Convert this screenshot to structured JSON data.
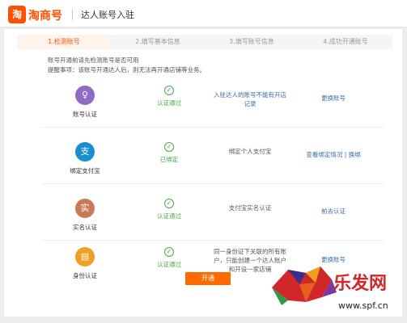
{
  "header": {
    "logo_glyph": "淘",
    "logo_text": "淘商号",
    "page_title": "达人账号入驻"
  },
  "steps": [
    {
      "label": "1.检测账号",
      "active": true
    },
    {
      "label": "2.填写基本信息",
      "active": false
    },
    {
      "label": "3.填写账号信息",
      "active": false
    },
    {
      "label": "4.成功开通账号",
      "active": false
    }
  ],
  "intro": {
    "line1": "账号开通前请先检测账号是否可用",
    "line2": "提醒事项：该账号开通达人后，则无法再开通店铺等业务。"
  },
  "rows": [
    {
      "label": "账号认证",
      "icon": "user-icon",
      "icon_glyph": "♀",
      "icon_color": "#8f6ac8",
      "status": "认证通过",
      "desc": "入驻达人的账号不能有开店记录",
      "desc_color": "#3a6ea5",
      "action": "更换账号"
    },
    {
      "label": "绑定支付宝",
      "icon": "alipay-icon",
      "icon_glyph": "支",
      "icon_color": "#1a8fd0",
      "status": "已绑定",
      "desc": "绑定个人支付宝",
      "desc_color": "#555555",
      "action": "查看绑定情况 | 换绑"
    },
    {
      "label": "实名认证",
      "icon": "id-verify-icon",
      "icon_glyph": "实",
      "icon_color": "#c87a56",
      "status": "认证通过",
      "desc": "支付宝实名认证",
      "desc_color": "#555555",
      "action": "前去认证"
    },
    {
      "label": "身份认证",
      "icon": "id-card-icon",
      "icon_glyph": "▤",
      "icon_color": "#f0a020",
      "status": "认证通过",
      "desc": "同一身份证下关联的所有账户，只能创建一个达人账户和开设一家店铺",
      "desc_color": "#555555",
      "action": "更换账号"
    }
  ],
  "submit_label": "开通",
  "watermark": {
    "brand": "乐发网",
    "url": "www.spf.cn"
  },
  "colors": {
    "accent": "#ff5000",
    "success": "#4aa54a",
    "link": "#3a6ea5"
  }
}
